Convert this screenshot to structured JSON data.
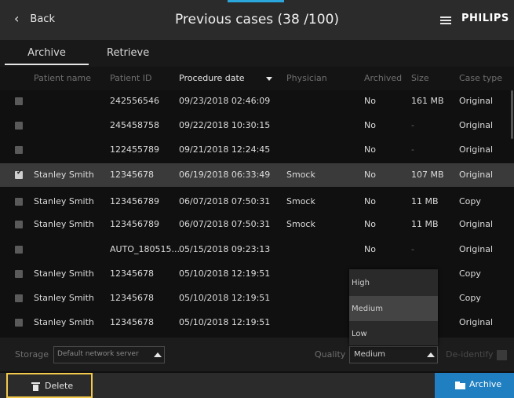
{
  "header": {
    "back_label": "Back",
    "title": "Previous cases (38 /100)",
    "brand": "PHILIPS"
  },
  "tabs": [
    {
      "label": "Archive",
      "active": true
    },
    {
      "label": "Retrieve",
      "active": false
    }
  ],
  "table": {
    "columns": [
      "Patient name",
      "Patient ID",
      "Procedure date",
      "Physician",
      "Archived",
      "Size",
      "Case type"
    ],
    "rows": [
      {
        "checked": false,
        "patient_name": "",
        "patient_id": "242556546",
        "procedure_date": "09/23/2018 02:46:09",
        "physician": "",
        "archived": "No",
        "size": "161 MB",
        "case_type": "Original"
      },
      {
        "checked": false,
        "patient_name": "",
        "patient_id": "245458758",
        "procedure_date": "09/22/2018 10:30:15",
        "physician": "",
        "archived": "No",
        "size": "-",
        "case_type": "Original"
      },
      {
        "checked": false,
        "patient_name": "",
        "patient_id": "122455789",
        "procedure_date": "09/21/2018 12:24:45",
        "physician": "",
        "archived": "No",
        "size": "-",
        "case_type": "Original"
      },
      {
        "checked": true,
        "patient_name": "Stanley Smith",
        "patient_id": "12345678",
        "procedure_date": "06/19/2018 06:33:49",
        "physician": "Smock",
        "archived": "No",
        "size": "107 MB",
        "case_type": "Original"
      },
      {
        "checked": false,
        "patient_name": "Stanley Smith",
        "patient_id": "123456789",
        "procedure_date": "06/07/2018 07:50:31",
        "physician": "Smock",
        "archived": "No",
        "size": "11 MB",
        "case_type": "Copy"
      },
      {
        "checked": false,
        "patient_name": "Stanley Smith",
        "patient_id": "123456789",
        "procedure_date": "06/07/2018 07:50:31",
        "physician": "Smock",
        "archived": "No",
        "size": "11 MB",
        "case_type": "Original"
      },
      {
        "checked": false,
        "patient_name": "",
        "patient_id": "AUTO_180515...",
        "procedure_date": "05/15/2018 09:23:13",
        "physician": "",
        "archived": "No",
        "size": "-",
        "case_type": "Original"
      },
      {
        "checked": false,
        "patient_name": "Stanley Smith",
        "patient_id": "12345678",
        "procedure_date": "05/10/2018 12:19:51",
        "physician": "",
        "archived": "",
        "size": "",
        "case_type": "Copy"
      },
      {
        "checked": false,
        "patient_name": "Stanley Smith",
        "patient_id": "12345678",
        "procedure_date": "05/10/2018 12:19:51",
        "physician": "",
        "archived": "",
        "size": "",
        "case_type": "Copy"
      },
      {
        "checked": false,
        "patient_name": "Stanley Smith",
        "patient_id": "12345678",
        "procedure_date": "05/10/2018 12:19:51",
        "physician": "",
        "archived": "",
        "size": "",
        "case_type": "Original"
      }
    ]
  },
  "settings": {
    "storage_label": "Storage",
    "storage_value": "Default network server",
    "quality_label": "Quality",
    "quality_value": "Medium",
    "quality_options": [
      "High",
      "Medium",
      "Low"
    ],
    "deidentify_label": "De-identify"
  },
  "actions": {
    "delete_label": "Delete",
    "archive_label": "Archive"
  },
  "colors": {
    "accent": "#2aa6dd",
    "archive_button": "#1f7fc0",
    "focus_outline": "#f2c94c"
  }
}
